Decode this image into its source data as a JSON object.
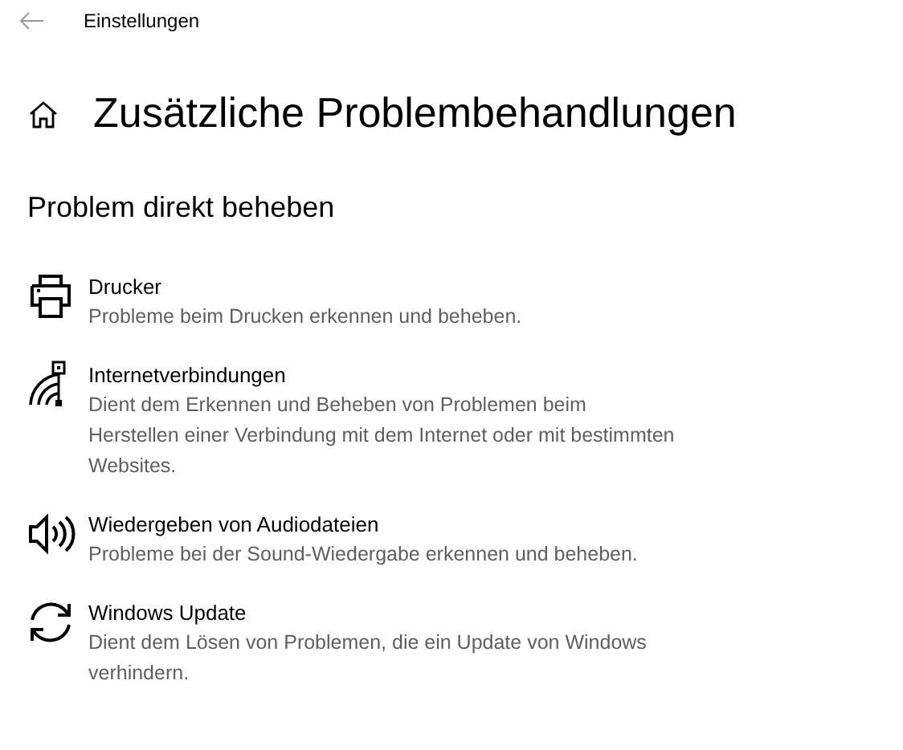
{
  "window": {
    "title": "Einstellungen"
  },
  "page": {
    "title": "Zusätzliche Problembehandlungen"
  },
  "section": {
    "title": "Problem direkt beheben"
  },
  "items": [
    {
      "kind": "printer",
      "title": "Drucker",
      "description": "Probleme beim Drucken erkennen und beheben."
    },
    {
      "kind": "network",
      "title": "Internetverbindungen",
      "description": "Dient dem Erkennen und Beheben von Problemen beim Herstellen einer Verbindung mit dem Internet oder mit bestimmten Websites."
    },
    {
      "kind": "audio",
      "title": "Wiedergeben von Audiodateien",
      "description": "Probleme bei der Sound-Wiedergabe erkennen und beheben."
    },
    {
      "kind": "update",
      "title": "Windows Update",
      "description": "Dient dem Lösen von Problemen, die ein Update von Windows verhindern."
    }
  ]
}
